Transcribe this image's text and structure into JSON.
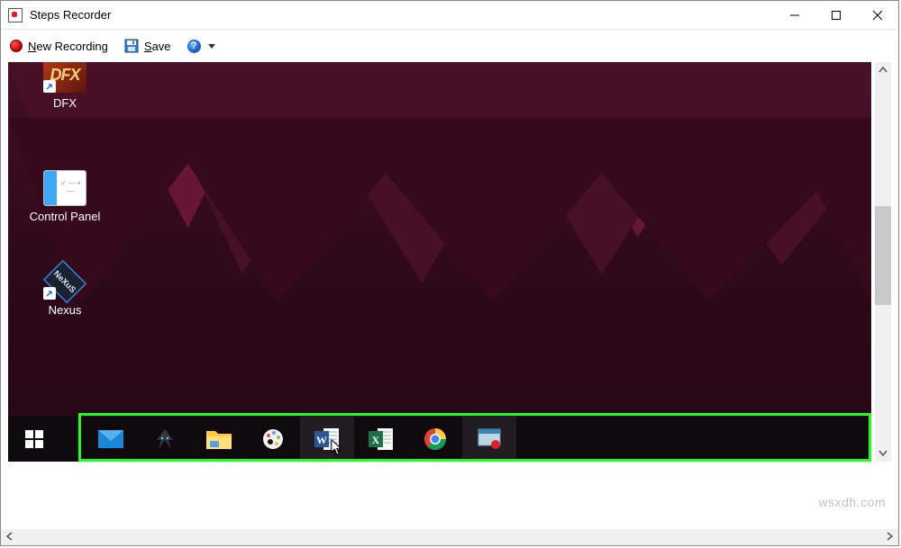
{
  "window": {
    "title": "Steps Recorder"
  },
  "toolbar": {
    "new_recording_label": "New Recording",
    "save_label": "Save",
    "help_label": "?"
  },
  "desktop_icons": {
    "dfx": {
      "label": "DFX"
    },
    "control_panel": {
      "label": "Control Panel"
    },
    "nexus": {
      "label": "Nexus"
    }
  },
  "taskbar": {
    "items": [
      {
        "name": "start-button",
        "icon": "windows-logo-icon"
      },
      {
        "name": "mail-app",
        "icon": "mail-icon"
      },
      {
        "name": "predator-app",
        "icon": "predator-icon"
      },
      {
        "name": "file-explorer",
        "icon": "folder-icon"
      },
      {
        "name": "paint-net",
        "icon": "paintnet-icon"
      },
      {
        "name": "word",
        "icon": "word-icon",
        "active": true
      },
      {
        "name": "excel",
        "icon": "excel-icon"
      },
      {
        "name": "chrome",
        "icon": "chrome-icon"
      },
      {
        "name": "steps-recorder-task",
        "icon": "steps-recorder-icon",
        "active": true
      }
    ]
  },
  "watermark": "wsxdh.com"
}
